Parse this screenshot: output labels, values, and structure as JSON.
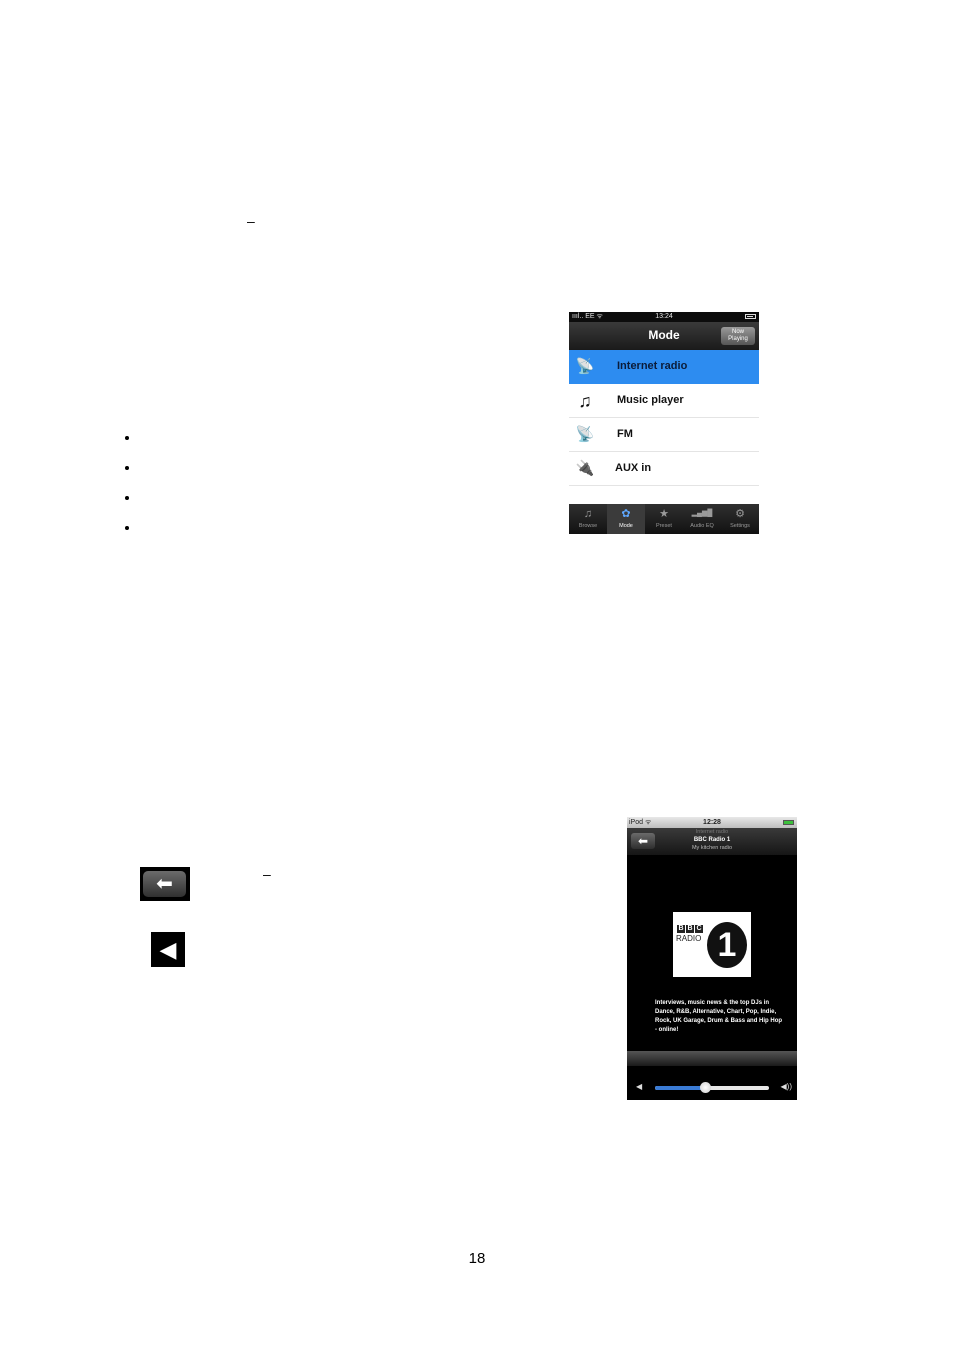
{
  "document": {
    "page_number": "18",
    "dashes": [
      "–",
      "–"
    ],
    "bullets_count": 4
  },
  "mode_screen": {
    "status_bar": {
      "signal": "ıııl.. EE ᯤ",
      "time": "13:24"
    },
    "nav": {
      "title": "Mode",
      "now_playing_line1": "Now",
      "now_playing_line2": "Playing"
    },
    "items": [
      {
        "label": "Internet radio",
        "icon": "radio-tower-icon",
        "glyph": "📡",
        "selected": true
      },
      {
        "label": "Music player",
        "icon": "music-note-icon",
        "glyph": "♫",
        "selected": false
      },
      {
        "label": "FM",
        "icon": "radio-tower-icon",
        "glyph": "📡",
        "selected": false
      },
      {
        "label": "AUX in",
        "icon": "aux-cable-icon",
        "glyph": "🔌",
        "selected": false
      }
    ],
    "tabs": [
      {
        "label": "Browse",
        "icon": "browse-icon",
        "glyph": "♫",
        "active": false
      },
      {
        "label": "Mode",
        "icon": "mode-icon",
        "glyph": "✿",
        "active": true
      },
      {
        "label": "Preset",
        "icon": "star-icon",
        "glyph": "★",
        "active": false
      },
      {
        "label": "Audio EQ",
        "icon": "equalizer-icon",
        "glyph": "▂▄▆█",
        "active": false
      },
      {
        "label": "Settings",
        "icon": "gear-icon",
        "glyph": "⚙",
        "active": false
      }
    ],
    "accent_color": "#2d8cf0"
  },
  "now_playing_screen": {
    "status_bar": {
      "device": "iPod ᯤ",
      "time": "12:28"
    },
    "nav": {
      "mode": "Internet radio",
      "station": "BBC Radio 1",
      "device_name": "My kitchen radio",
      "back_glyph": "⬅"
    },
    "logo": {
      "bbc": [
        "B",
        "B",
        "C"
      ],
      "radio": "RADIO",
      "number": "1"
    },
    "description": "Interviews, music news & the top DJs in Dance, R&B, Alternative, Chart, Pop, Indie, Rock, UK Garage, Drum & Bass and Hip Hop - online!",
    "volume": {
      "min_glyph": "◀",
      "max_glyph": "◀))",
      "level_fraction": 0.44
    }
  },
  "legend_icons": {
    "back_glyph": "⬅",
    "volume_glyph": "◀"
  }
}
